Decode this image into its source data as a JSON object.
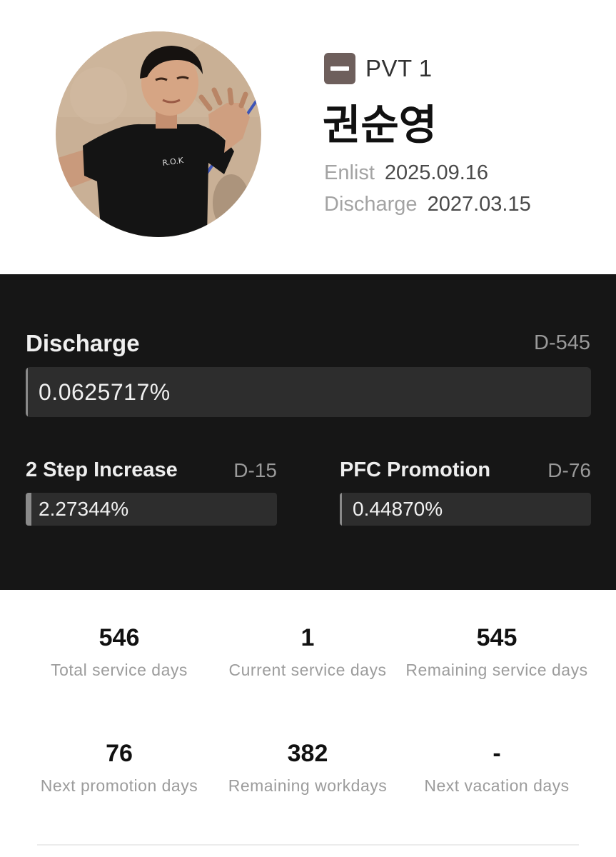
{
  "profile": {
    "rank_label": "PVT 1",
    "rank_icon": "private-rank-icon",
    "name": "권순영",
    "enlist": {
      "label": "Enlist",
      "value": "2025.09.16"
    },
    "discharge": {
      "label": "Discharge",
      "value": "2027.03.15"
    }
  },
  "progress": {
    "main": {
      "title": "Discharge",
      "dday": "D-545",
      "value_text": "0.0625717%",
      "percent": 0.0625717
    },
    "step": {
      "title": "2 Step Increase",
      "dday": "D-15",
      "value_text": "2.27344%",
      "percent": 2.27344
    },
    "promotion": {
      "title": "PFC Promotion",
      "dday": "D-76",
      "value_text": "0.44870%",
      "percent": 0.4487
    }
  },
  "stats": [
    {
      "value": "546",
      "label": "Total service days"
    },
    {
      "value": "1",
      "label": "Current service days"
    },
    {
      "value": "545",
      "label": "Remaining service days"
    },
    {
      "value": "76",
      "label": "Next promotion days"
    },
    {
      "value": "382",
      "label": "Remaining workdays"
    },
    {
      "value": "-",
      "label": "Next vacation days"
    }
  ],
  "colors": {
    "panel_bg": "#161616",
    "track": "#2d2d2d",
    "fill": "#8a8a8a",
    "rank_badge": "#6e5f5c"
  }
}
